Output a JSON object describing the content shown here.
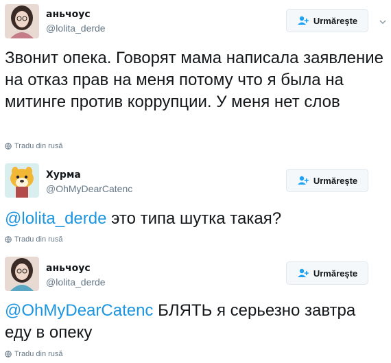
{
  "tweets": [
    {
      "name": "аньчоус",
      "handle": "@lolita_derde",
      "follow_label": "Urmărește",
      "text": "Звонит опека. Говорят мама написала заявление на отказ прав на меня потому что я была на митинге против коррупции. У меня нет слов",
      "translate_label": "Tradu din rusă"
    },
    {
      "name": "Хурма",
      "handle": "@OhMyDearCatenc",
      "follow_label": "Urmărește",
      "mention": "@lolita_derde",
      "text": " это типа шутка такая?",
      "translate_label": "Tradu din rusă"
    },
    {
      "name": "аньчоус",
      "handle": "@lolita_derde",
      "follow_label": "Urmărește",
      "mention": "@OhMyDearCatenc",
      "text": " БЛЯТЬ я серьезно завтра еду в опеку",
      "translate_label": "Tradu din rusă"
    }
  ],
  "colors": {
    "link": "#1b95e0",
    "secondary_text": "#657786",
    "button_bg": "#f5f8fa",
    "button_border": "#e1e8ed",
    "follow_icon": "#1da1f2"
  },
  "icons": {
    "follow": "add-user-icon",
    "caret": "chevron-down-icon",
    "translate": "globe-icon"
  }
}
